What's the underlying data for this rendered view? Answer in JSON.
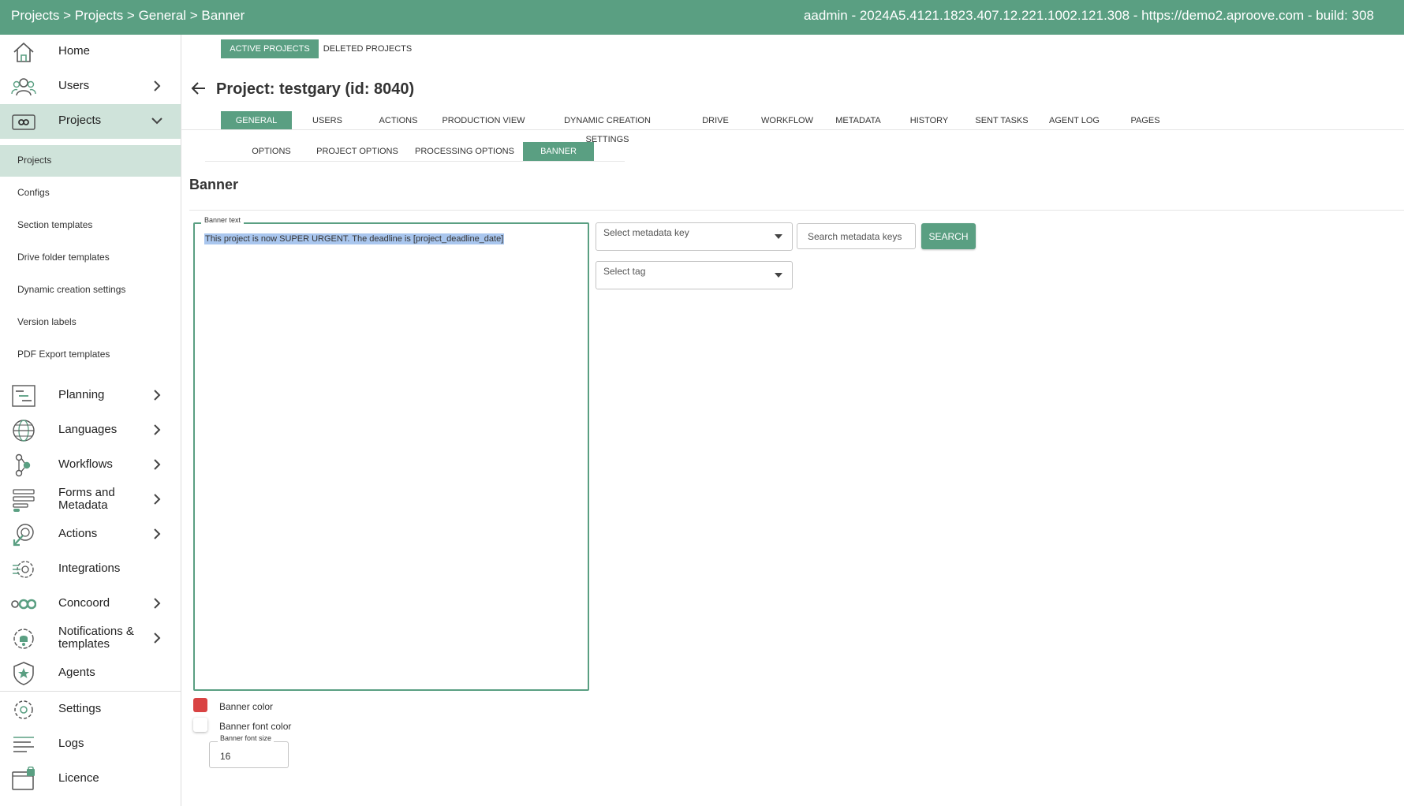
{
  "header": {
    "breadcrumb": "Projects > Projects > General > Banner",
    "info": "aadmin - 2024A5.4121.1823.407.12.221.1002.121.308 - https://demo2.aproove.com - build: 308"
  },
  "sidebar": {
    "items": [
      {
        "label": "Home",
        "icon": "home-icon"
      },
      {
        "label": "Users",
        "icon": "users-icon"
      },
      {
        "label": "Projects",
        "icon": "projects-icon"
      },
      {
        "label": "Planning",
        "icon": "planning-icon"
      },
      {
        "label": "Languages",
        "icon": "globe-icon"
      },
      {
        "label": "Workflows",
        "icon": "workflow-icon"
      },
      {
        "label": "Forms and Metadata",
        "icon": "forms-icon"
      },
      {
        "label": "Actions",
        "icon": "actions-icon"
      },
      {
        "label": "Integrations",
        "icon": "integrations-icon"
      },
      {
        "label": "Concoord",
        "icon": "concoord-icon"
      },
      {
        "label": "Notifications & templates",
        "icon": "notifications-icon"
      },
      {
        "label": "Agents",
        "icon": "agents-icon"
      },
      {
        "label": "Settings",
        "icon": "settings-icon"
      },
      {
        "label": "Logs",
        "icon": "logs-icon"
      },
      {
        "label": "Licence",
        "icon": "licence-icon"
      }
    ],
    "project_subitems": [
      "Projects",
      "Configs",
      "Section templates",
      "Drive folder templates",
      "Dynamic creation settings",
      "Version labels",
      "PDF Export templates"
    ]
  },
  "top_tabs": [
    "ACTIVE PROJECTS",
    "DELETED PROJECTS"
  ],
  "project": {
    "title": "Project: testgary  (id: 8040)"
  },
  "main_tabs": [
    "GENERAL",
    "USERS",
    "ACTIONS",
    "PRODUCTION VIEW",
    "DYNAMIC CREATION SETTINGS",
    "DRIVE",
    "WORKFLOW",
    "METADATA",
    "HISTORY",
    "SENT TASKS",
    "AGENT LOG",
    "PAGES"
  ],
  "sub_tabs": [
    "OPTIONS",
    "PROJECT OPTIONS",
    "PROCESSING OPTIONS",
    "BANNER"
  ],
  "banner": {
    "section_title": "Banner",
    "text_label": "Banner text",
    "text_value": "This project is now SUPER URGENT. The deadline is [project_deadline_date]",
    "metadata_key_placeholder": "Select metadata key",
    "search_placeholder": "Search metadata keys",
    "search_button": "SEARCH",
    "tag_placeholder": "Select tag",
    "color_label": "Banner color",
    "color_value": "#d94343",
    "font_color_label": "Banner font color",
    "font_color_value": "#ffffff",
    "font_size_label": "Banner font size",
    "font_size_value": "16"
  },
  "colors": {
    "accent": "#5a9f82",
    "active_bg": "#cfe3da"
  }
}
